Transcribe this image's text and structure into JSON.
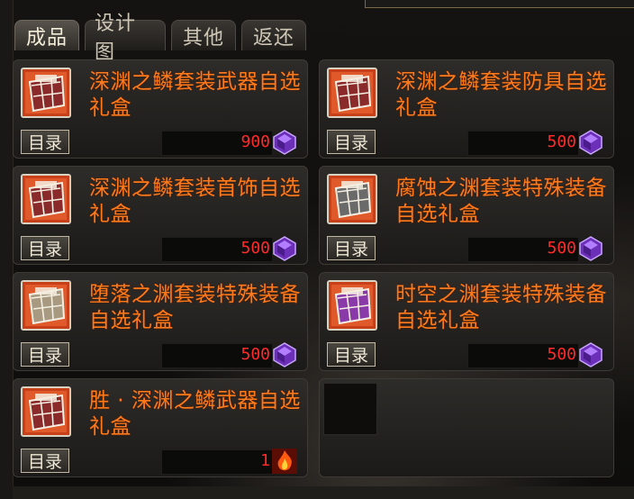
{
  "tabs": [
    "成品",
    "设计图",
    "其他",
    "返还"
  ],
  "catalog_label": "目录",
  "items": [
    {
      "title": "深渊之鳞套装武器自选礼盒",
      "price": "900",
      "currency_icon": "purple-crystal-icon",
      "icon": "weapon-giftbox-icon",
      "icon_tint": "#8a2a2a"
    },
    {
      "title": "深渊之鳞套装防具自选礼盒",
      "price": "500",
      "currency_icon": "purple-crystal-icon",
      "icon": "armor-giftbox-icon",
      "icon_tint": "#8a2a2a"
    },
    {
      "title": "深渊之鳞套装首饰自选礼盒",
      "price": "500",
      "currency_icon": "purple-crystal-icon",
      "icon": "accessory-giftbox-icon",
      "icon_tint": "#8a2a2a"
    },
    {
      "title": "腐蚀之渊套装特殊装备自选礼盒",
      "price": "500",
      "currency_icon": "purple-crystal-icon",
      "icon": "special-giftbox-icon",
      "icon_tint": "#6a6a6a"
    },
    {
      "title": "堕落之渊套装特殊装备自选礼盒",
      "price": "500",
      "currency_icon": "purple-crystal-icon",
      "icon": "special-giftbox-icon",
      "icon_tint": "#a89a80"
    },
    {
      "title": "时空之渊套装特殊装备自选礼盒",
      "price": "500",
      "currency_icon": "purple-crystal-icon",
      "icon": "special-giftbox-icon",
      "icon_tint": "#8a3aa8"
    },
    {
      "title": "胜 · 深渊之鳞武器自选礼盒",
      "price": "1",
      "currency_icon": "fire-token-icon",
      "icon": "weapon-giftbox-icon",
      "icon_tint": "#8a2a2a"
    }
  ]
}
